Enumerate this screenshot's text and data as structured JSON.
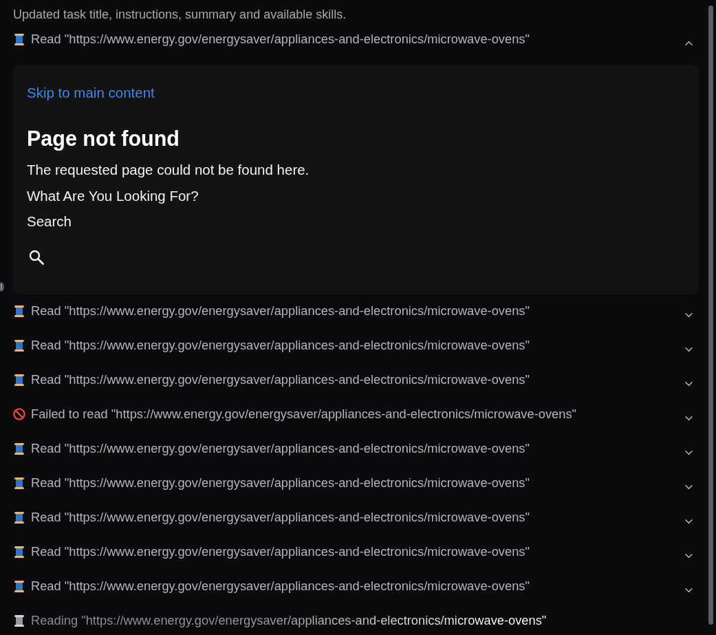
{
  "status_message": "Updated task title, instructions, summary and available skills.",
  "steps": [
    {
      "kind": "read",
      "label": "Read \"https://www.energy.gov/energysaver/appliances-and-electronics/microwave-ovens\"",
      "expanded": true,
      "preview": {
        "skip_link": "Skip to main content",
        "heading": "Page not found",
        "paragraphs": [
          "The requested page could not be found here.",
          "What Are You Looking For?",
          "Search"
        ]
      }
    },
    {
      "kind": "read",
      "label": "Read \"https://www.energy.gov/energysaver/appliances-and-electronics/microwave-ovens\"",
      "expanded": false
    },
    {
      "kind": "read",
      "label": "Read \"https://www.energy.gov/energysaver/appliances-and-electronics/microwave-ovens\"",
      "expanded": false
    },
    {
      "kind": "read",
      "label": "Read \"https://www.energy.gov/energysaver/appliances-and-electronics/microwave-ovens\"",
      "expanded": false
    },
    {
      "kind": "failed",
      "label": "Failed to read \"https://www.energy.gov/energysaver/appliances-and-electronics/microwave-ovens\"",
      "expanded": false
    },
    {
      "kind": "read",
      "label": "Read \"https://www.energy.gov/energysaver/appliances-and-electronics/microwave-ovens\"",
      "expanded": false
    },
    {
      "kind": "read",
      "label": "Read \"https://www.energy.gov/energysaver/appliances-and-electronics/microwave-ovens\"",
      "expanded": false
    },
    {
      "kind": "read",
      "label": "Read \"https://www.energy.gov/energysaver/appliances-and-electronics/microwave-ovens\"",
      "expanded": false
    },
    {
      "kind": "read",
      "label": "Read \"https://www.energy.gov/energysaver/appliances-and-electronics/microwave-ovens\"",
      "expanded": false
    },
    {
      "kind": "read",
      "label": "Read \"https://www.energy.gov/energysaver/appliances-and-electronics/microwave-ovens\"",
      "expanded": false
    },
    {
      "kind": "reading",
      "label": "Reading \"https://www.energy.gov/energysaver/appliances-and-electronics/microwave-ovens\""
    }
  ]
}
